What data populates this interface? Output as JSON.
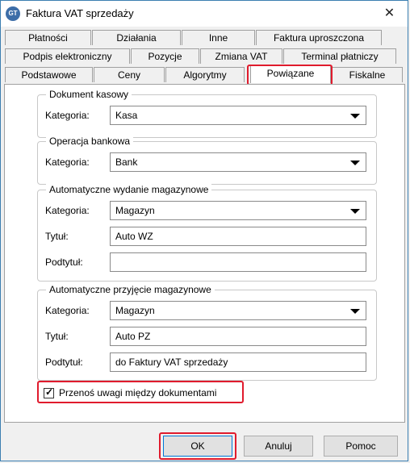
{
  "window": {
    "title": "Faktura VAT sprzedaży",
    "icon_text": "GT",
    "close_glyph": "✕"
  },
  "tabs": {
    "row1": [
      "Płatności",
      "Działania",
      "Inne",
      "Faktura uproszczona"
    ],
    "row2": [
      "Podpis elektroniczny",
      "Pozycje",
      "Zmiana VAT",
      "Terminal płatniczy"
    ],
    "row3": [
      "Podstawowe",
      "Ceny",
      "Algorytmy",
      "Powiązane",
      "Fiskalne"
    ],
    "active": "Powiązane"
  },
  "groups": {
    "dokument_kasowy": {
      "legend": "Dokument kasowy",
      "kategoria_label": "Kategoria:",
      "kategoria_value": "Kasa"
    },
    "operacja_bankowa": {
      "legend": "Operacja bankowa",
      "kategoria_label": "Kategoria:",
      "kategoria_value": "Bank"
    },
    "wydanie": {
      "legend": "Automatyczne wydanie magazynowe",
      "kategoria_label": "Kategoria:",
      "kategoria_value": "Magazyn",
      "tytul_label": "Tytuł:",
      "tytul_value": "Auto WZ",
      "podtytul_label": "Podtytuł:",
      "podtytul_value": ""
    },
    "przyjecie": {
      "legend": "Automatyczne przyjęcie magazynowe",
      "kategoria_label": "Kategoria:",
      "kategoria_value": "Magazyn",
      "tytul_label": "Tytuł:",
      "tytul_value": "Auto PZ",
      "podtytul_label": "Podtytuł:",
      "podtytul_value": "do Faktury VAT sprzedaży"
    }
  },
  "checkbox": {
    "label": "Przenoś uwagi między dokumentami",
    "checked": true
  },
  "buttons": {
    "ok": "OK",
    "cancel": "Anuluj",
    "help": "Pomoc"
  },
  "colors": {
    "highlight": "#e01b2d",
    "accent": "#0078d7"
  }
}
